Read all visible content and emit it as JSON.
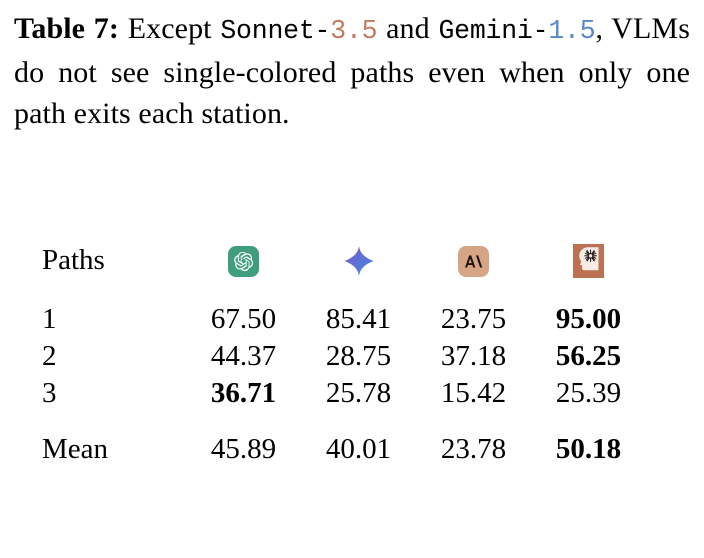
{
  "caption": {
    "label": "Table 7:",
    "text_1": "Except",
    "model_1_name": "Sonnet-",
    "model_1_version": "3.5",
    "text_2": "and",
    "model_2_name": "Gemini-",
    "model_2_version": "1.5",
    "text_3": ", VLMs do not see single-colored paths even when only one path exits each station.",
    "version_colors": {
      "sonnet": "#c4795d",
      "gemini": "#5588cc"
    }
  },
  "table": {
    "header": {
      "row_label": "Paths",
      "columns": [
        {
          "icon": "openai-logo-icon",
          "label": "GPT",
          "badge_color": "#3f9e7d"
        },
        {
          "icon": "gemini-sparkle-icon",
          "label": "Gemini",
          "badge_color": "#5c6fd0"
        },
        {
          "icon": "anthropic-logo-icon",
          "label": "Claude",
          "badge_color": "#d6a585"
        },
        {
          "icon": "human-head-icon",
          "label": "Human",
          "badge_color": "#bd7153"
        }
      ]
    },
    "rows": [
      {
        "label": "1",
        "values": [
          "67.50",
          "85.41",
          "23.75",
          "95.00"
        ],
        "bold": [
          false,
          false,
          false,
          true
        ]
      },
      {
        "label": "2",
        "values": [
          "44.37",
          "28.75",
          "37.18",
          "56.25"
        ],
        "bold": [
          false,
          false,
          false,
          true
        ]
      },
      {
        "label": "3",
        "values": [
          "36.71",
          "25.78",
          "15.42",
          "25.39"
        ],
        "bold": [
          true,
          false,
          false,
          false
        ]
      }
    ],
    "summary": {
      "label": "Mean",
      "values": [
        "45.89",
        "40.01",
        "23.78",
        "50.18"
      ],
      "bold": [
        false,
        false,
        false,
        true
      ]
    }
  }
}
